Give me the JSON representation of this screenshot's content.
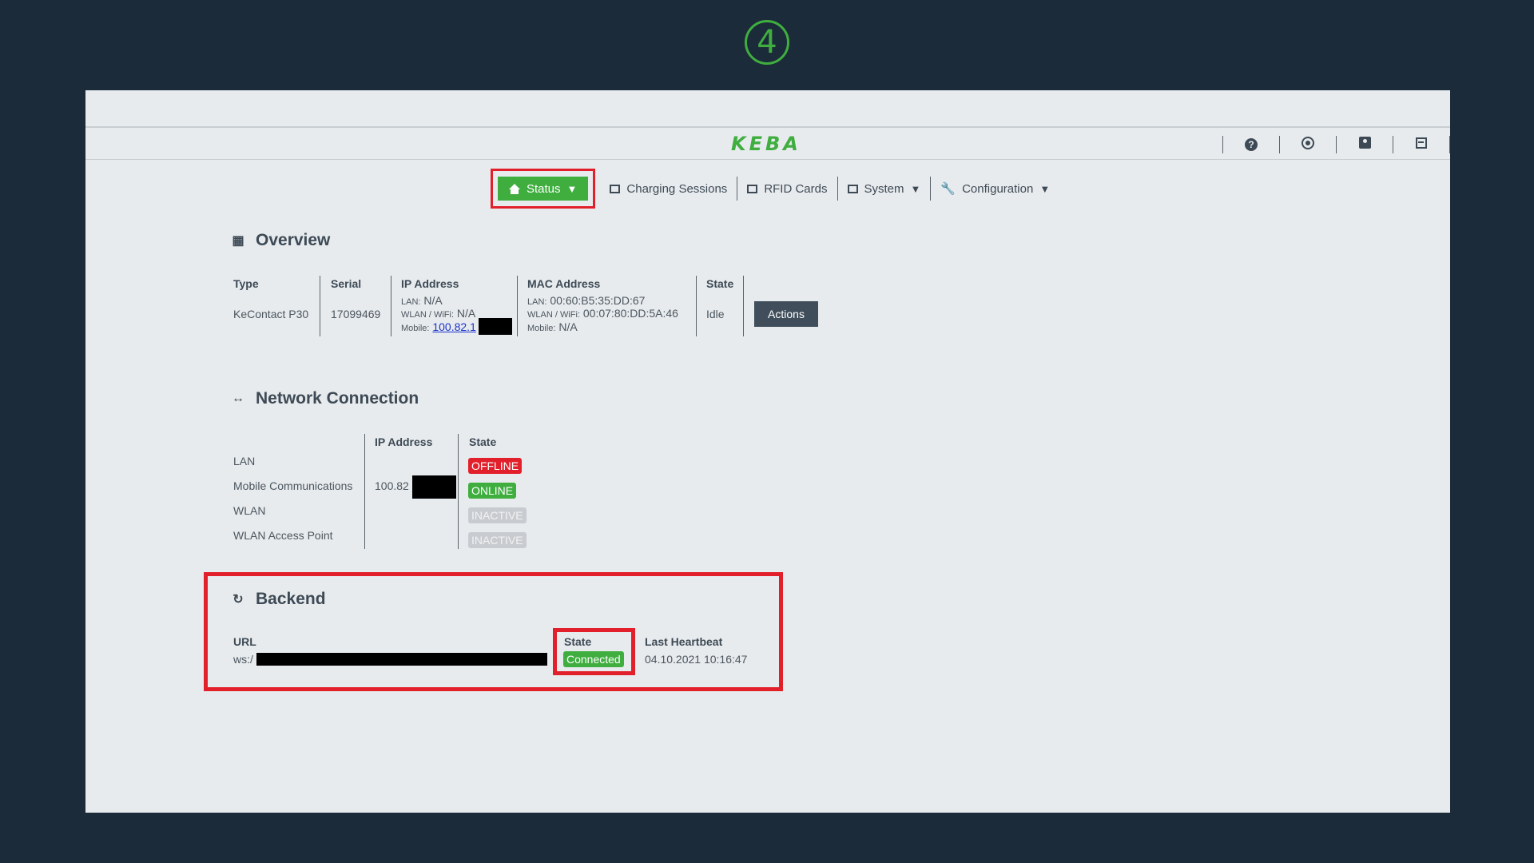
{
  "step": "4",
  "logo": "KEBA",
  "header_icons": [
    "help-icon",
    "target-icon",
    "user-icon",
    "logout-icon"
  ],
  "nav": {
    "status": "Status",
    "charging_sessions": "Charging Sessions",
    "rfid_cards": "RFID Cards",
    "system": "System",
    "configuration": "Configuration",
    "caret": "▼"
  },
  "overview": {
    "title": "Overview",
    "headers": {
      "type": "Type",
      "serial": "Serial",
      "ip": "IP Address",
      "mac": "MAC Address",
      "state": "State"
    },
    "type": "KeContact P30",
    "serial": "17099469",
    "ip": {
      "lan_label": "LAN:",
      "lan_value": "N/A",
      "wlan_label": "WLAN / WiFi:",
      "wlan_value": "N/A",
      "mobile_label": "Mobile:",
      "mobile_value": "100.82.1"
    },
    "mac": {
      "lan_label": "LAN:",
      "lan_value": "00:60:B5:35:DD:67",
      "wlan_label": "WLAN / WiFi:",
      "wlan_value": "00:07:80:DD:5A:46",
      "mobile_label": "Mobile:",
      "mobile_value": "N/A"
    },
    "state": "Idle",
    "actions": "Actions"
  },
  "network": {
    "title": "Network Connection",
    "headers": {
      "ip": "IP Address",
      "state": "State"
    },
    "rows": [
      {
        "name": "LAN",
        "ip": "",
        "state": "OFFLINE"
      },
      {
        "name": "Mobile Communications",
        "ip": "100.82",
        "state": "ONLINE"
      },
      {
        "name": "WLAN",
        "ip": "",
        "state": "INACTIVE"
      },
      {
        "name": "WLAN Access Point",
        "ip": "",
        "state": "INACTIVE"
      }
    ]
  },
  "backend": {
    "title": "Backend",
    "headers": {
      "url": "URL",
      "state": "State",
      "heartbeat": "Last Heartbeat"
    },
    "url": "ws:/",
    "state": "Connected",
    "heartbeat": "04.10.2021 10:16:47"
  },
  "colors": {
    "accent": "#3fae3f",
    "highlight": "#e2202b",
    "background": "#1c2b39"
  }
}
